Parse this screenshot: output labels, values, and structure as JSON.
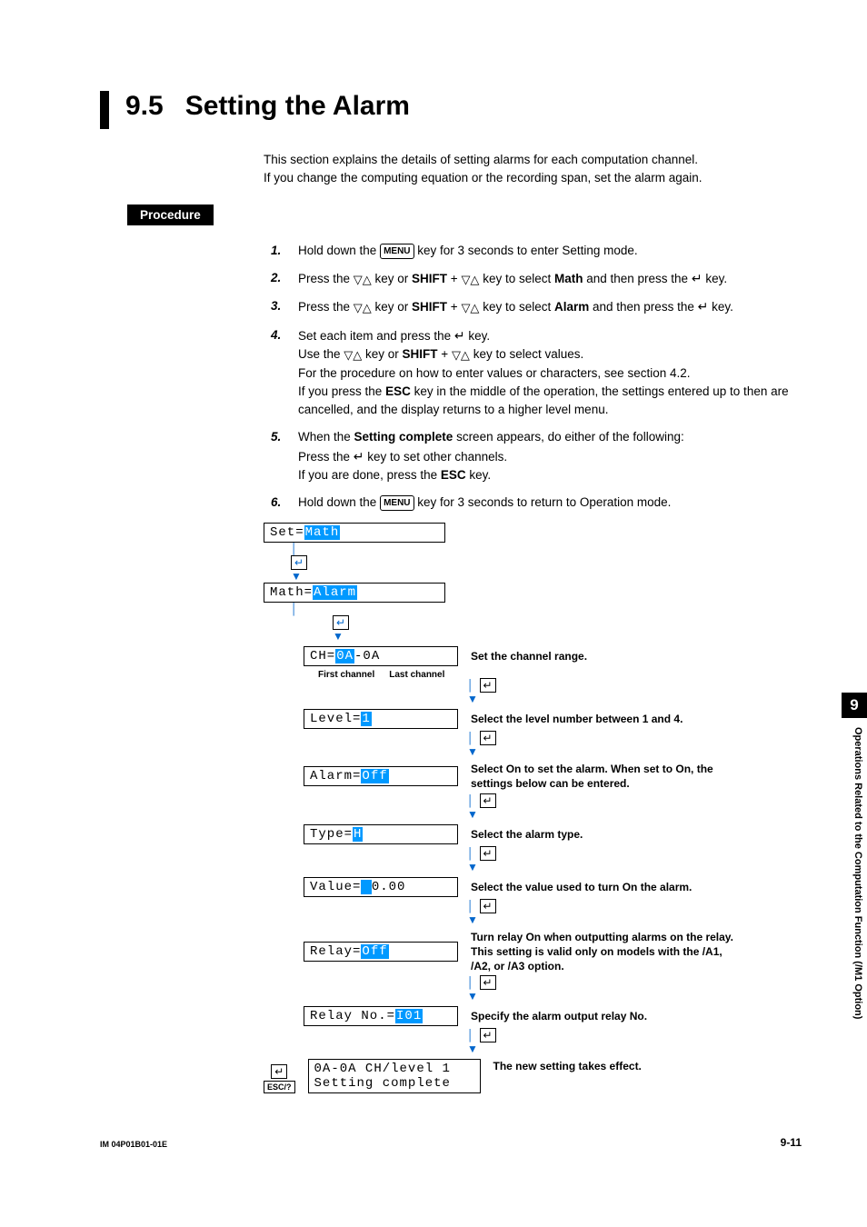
{
  "title": {
    "num": "9.5",
    "text": "Setting the Alarm"
  },
  "intro": {
    "l1": "This section explains the details of setting alarms for each computation channel.",
    "l2": "If you change the computing equation or the recording span, set the alarm again."
  },
  "procedure_label": "Procedure",
  "keys": {
    "menu": "MENU",
    "esc": "ESC",
    "shift": "SHIFT",
    "updown": "▽△",
    "enter": "↵"
  },
  "steps": {
    "s1a": "Hold down the ",
    "s1b": " key for 3 seconds to enter Setting mode.",
    "s2a": "Press the ",
    "s2b": " key or ",
    "s2c": " + ",
    "s2d": " key to select ",
    "s2e": "Math",
    "s2f": " and then press the ",
    "s2g": " key.",
    "s3a": "Press the ",
    "s3b": " key or ",
    "s3c": " + ",
    "s3d": " key to select ",
    "s3e": "Alarm",
    "s3f": " and then press the ",
    "s3g": " key.",
    "s4a": "Set each item and press the ",
    "s4b": " key.",
    "s4c": "Use the ",
    "s4d": " key or ",
    "s4e": " + ",
    "s4f": " key to select values.",
    "s4g": "For the procedure on how to enter values or characters, see section 4.2.",
    "s4h": "If you press the ",
    "s4i": " key in the middle of the operation, the settings entered up to then are cancelled, and the display returns to a higher level menu.",
    "s5a": "When the ",
    "s5b": "Setting complete",
    "s5c": " screen appears, do either of the following:",
    "s5d": "Press the ",
    "s5e": " key to set other channels.",
    "s5f": "If you are done, press the ",
    "s5g": " key.",
    "s6a": "Hold down the ",
    "s6b": " key for 3 seconds to return to Operation mode."
  },
  "diagram": {
    "set_prefix": "Set=",
    "set_val": "Math",
    "math_prefix": "Math=",
    "math_val": "Alarm",
    "ch_prefix": "CH=",
    "ch_v1": "0A",
    "ch_dash": "-0A",
    "first_ch": "First channel",
    "last_ch": "Last channel",
    "level_prefix": "Level=",
    "level_val": "1",
    "alarm_prefix": "Alarm=",
    "alarm_val": "Off",
    "type_prefix": "Type=",
    "type_val": "H",
    "value_prefix": "Value=",
    "value_sp": " ",
    "value_num": "   0.00",
    "relay_prefix": "Relay=",
    "relay_val": "Off",
    "relayno_prefix": "Relay No.=",
    "relayno_val": "I01",
    "complete_l1": "0A-0A CH/level  1",
    "complete_l2": "Setting complete",
    "esc_label": "ESC/?",
    "desc_ch": "Set the channel range.",
    "desc_level": "Select the level number between 1 and 4.",
    "desc_alarm": "Select On to set the alarm. When set to On, the settings below can be entered.",
    "desc_type": "Select the alarm type.",
    "desc_value": "Select the value used to turn On the alarm.",
    "desc_relay": "Turn relay On when outputting alarms on the relay. This setting is valid only on models with the /A1, /A2, or /A3 option.",
    "desc_relayno": "Specify the alarm output relay No.",
    "desc_complete": "The new setting takes effect."
  },
  "side": {
    "chapter": "9",
    "text": "Operations Related to the Computation Function (/M1 Option)"
  },
  "footer": {
    "left": "IM 04P01B01-01E",
    "right": "9-11"
  }
}
